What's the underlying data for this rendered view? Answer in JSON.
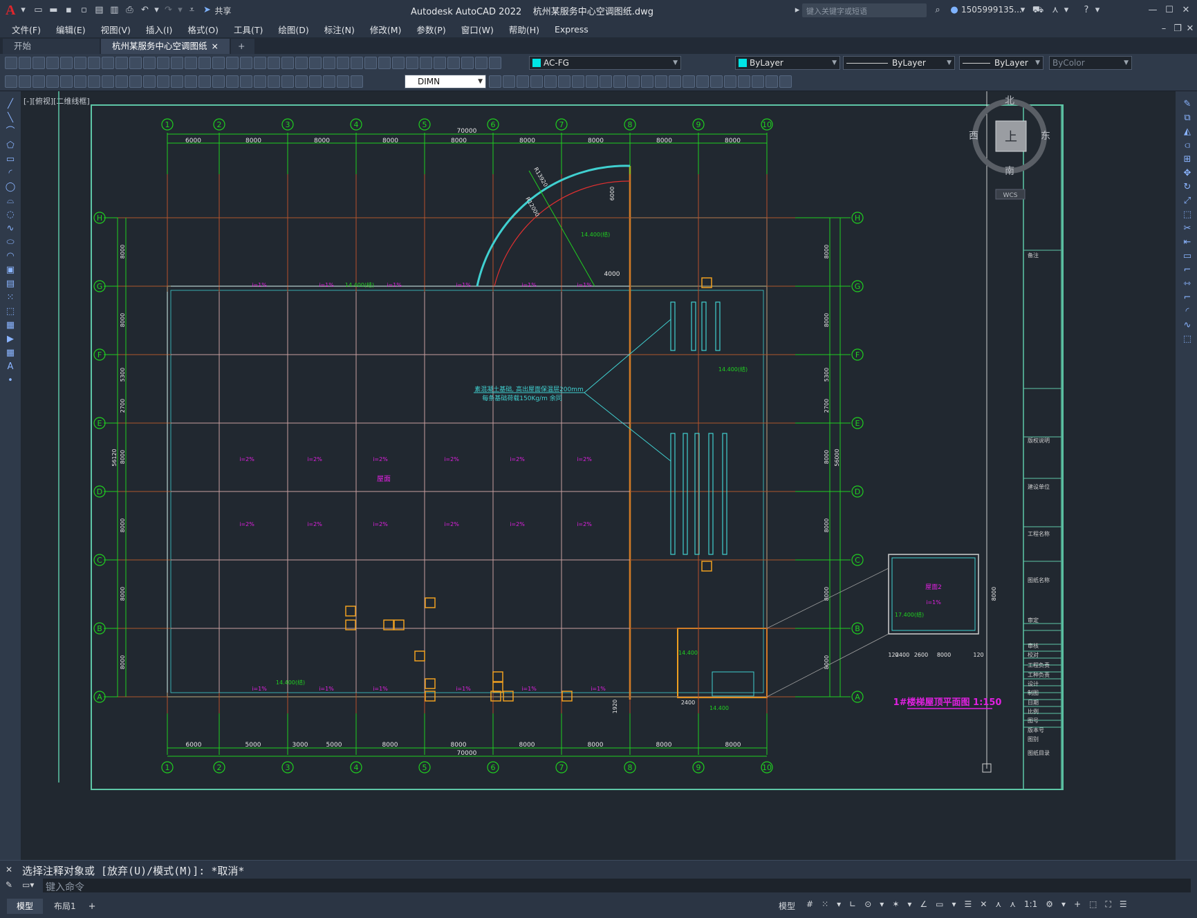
{
  "app": {
    "title": "Autodesk AutoCAD 2022    杭州某服务中心空调图纸.dwg",
    "share_label": "共享",
    "search_placeholder": "键入关键字或短语",
    "user": "1505999135...",
    "logo": "A"
  },
  "menu": [
    "文件(F)",
    "编辑(E)",
    "视图(V)",
    "插入(I)",
    "格式(O)",
    "工具(T)",
    "绘图(D)",
    "标注(N)",
    "修改(M)",
    "参数(P)",
    "窗口(W)",
    "帮助(H)",
    "Express"
  ],
  "tabs": {
    "start": "开始",
    "doc": "杭州某服务中心空调图纸*",
    "close": "×",
    "add": "+"
  },
  "toolbar": {
    "layer": "AC-FG",
    "color": "ByLayer",
    "linetype": "ByLayer",
    "lineweight": "ByLayer",
    "plotstyle": "ByColor",
    "dimstyle": "DIMN"
  },
  "viewport": {
    "label": "[-][俯视][二维线框]",
    "compass": {
      "n": "北",
      "s": "南",
      "e": "东",
      "w": "西",
      "top": "上",
      "wcs": "WCS"
    }
  },
  "drawing": {
    "grid_cols": [
      "1",
      "2",
      "3",
      "4",
      "5",
      "6",
      "7",
      "8",
      "9",
      "10"
    ],
    "grid_rows": [
      "H",
      "G",
      "F",
      "E",
      "D",
      "C",
      "B",
      "A"
    ],
    "top_dims": [
      "6000",
      "8000",
      "8000",
      "8000",
      "8000",
      "8000",
      "8000",
      "8000",
      "8000"
    ],
    "total_dim": "70000",
    "bottom_dims": [
      "6000",
      "5000",
      "3000",
      "5000",
      "8000",
      "8000",
      "8000",
      "8000",
      "8000",
      "8000"
    ],
    "right_dims": [
      "8000",
      "8000",
      "5300",
      "2700",
      "8000",
      "8000",
      "8000",
      "8000"
    ],
    "left_dims": [
      "8000",
      "8000",
      "5300",
      "2700",
      "8000",
      "8000",
      "8000",
      "8000"
    ],
    "left_total": "56120",
    "right_total": "56000",
    "slope": "i=2%",
    "slope1": "i=1%",
    "roof_label": "屋面",
    "elev1": "14.400(结)",
    "note1": "素混凝土基础, 高出屋面保温层200mm",
    "note2": "每条基础荷载150Kg/m 余同",
    "arc_r1": "R13920",
    "arc_r2": "R12000",
    "dim_4000": "4000",
    "dim_6000": "6000",
    "detail_title": "1#楼梯屋顶平面图 1:150",
    "detail_roof": "屋面2",
    "detail_elev": "17.400(结)",
    "detail_dims": [
      "120",
      "2400",
      "2600",
      "8000",
      "120"
    ],
    "detail_h": "8000",
    "elev2": "14.400",
    "dim_2400": "2400",
    "dim_1920": "1920",
    "titleblock": [
      "备注",
      "版权说明",
      "建设单位",
      "工程名称",
      "图纸名称",
      "审定",
      "审核",
      "校对",
      "工程负责",
      "工种负责",
      "设计",
      "制图",
      "日期",
      "比例",
      "图号",
      "版本号",
      "图别",
      "图纸目录"
    ]
  },
  "command": {
    "history": "选择注释对象或 [放弃(U)/模式(M)]: *取消*",
    "placeholder": "键入命令"
  },
  "status": {
    "model": "模型",
    "layout1": "布局1",
    "add": "+",
    "model_btn": "模型",
    "scale": "1:1"
  }
}
